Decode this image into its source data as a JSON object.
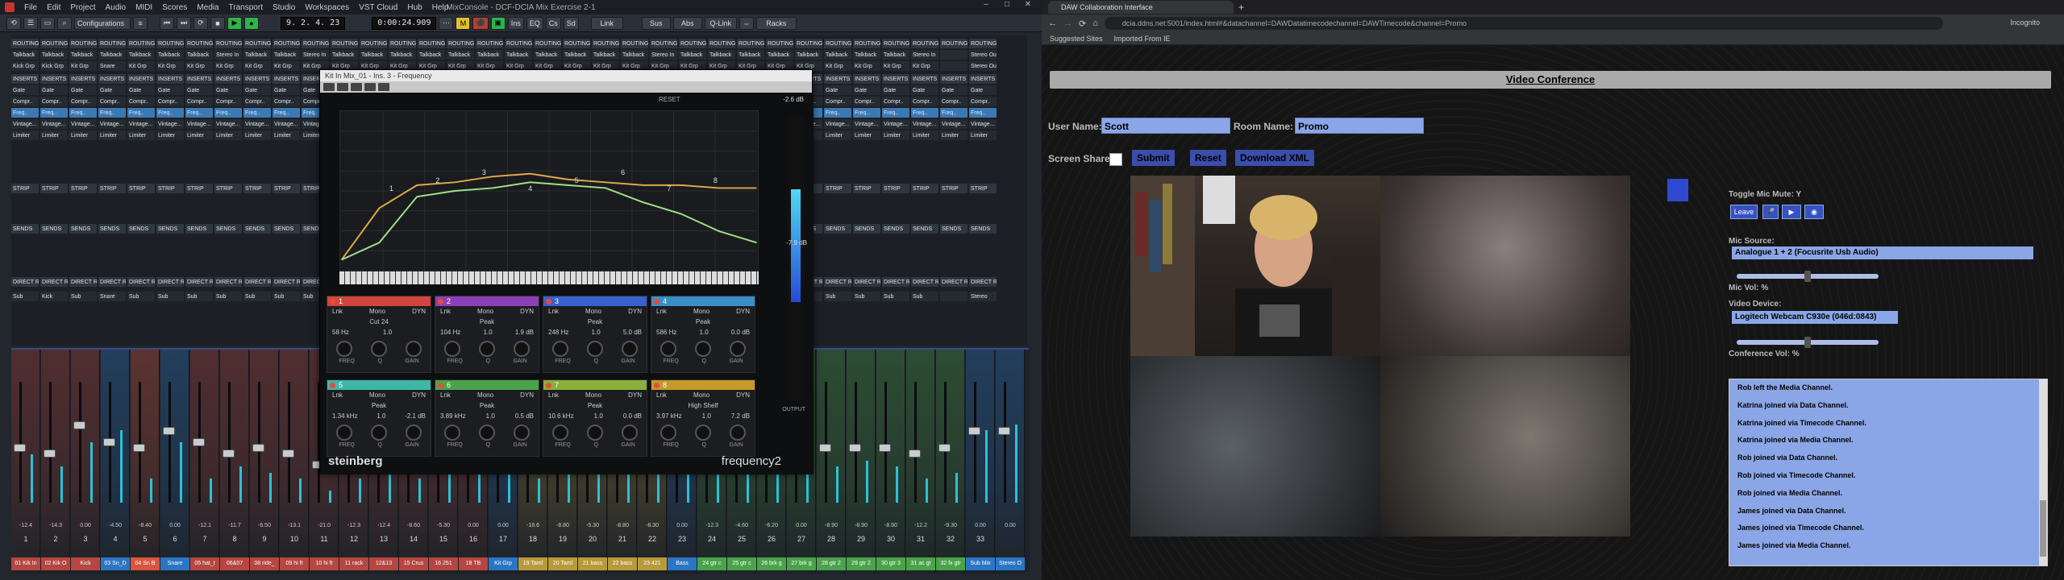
{
  "cubase": {
    "app_title": "MixConsole - DCF-DCIA Mix Exercise 2-1",
    "menu": [
      "File",
      "Edit",
      "Project",
      "Audio",
      "MIDI",
      "Scores",
      "Media",
      "Transport",
      "Studio",
      "Workspaces",
      "VST Cloud",
      "Hub",
      "Help"
    ],
    "window_controls": [
      "–",
      "□",
      "✕"
    ],
    "toolbar": {
      "configurations": "Configurations",
      "position": "9. 2. 4. 23",
      "timecode": "0:00:24.909",
      "metronome": "M",
      "sync_button": "Link",
      "buttons": [
        "Ins",
        "EQ",
        "Cs",
        "Sd"
      ],
      "sus_label": "Sus",
      "abs_label": "Abs",
      "q_link_label": "Q-Link",
      "racks_label": "Racks"
    },
    "rack_rows": {
      "routing": [
        "ROUTING",
        "ROUTING",
        "ROUTING",
        "ROUTING",
        "ROUTING",
        "ROUTING",
        "ROUTING",
        "ROUTING",
        "ROUTING",
        "ROUTING",
        "ROUTING",
        "ROUTING",
        "ROUTING",
        "ROUTING",
        "ROUTING",
        "ROUTING",
        "ROUTING",
        "ROUTING",
        "ROUTING",
        "ROUTING",
        "ROUTING",
        "ROUTING",
        "ROUTING",
        "ROUTING",
        "ROUTING",
        "ROUTING",
        "ROUTING",
        "ROUTING",
        "ROUTING",
        "ROUTING",
        "ROUTING",
        "ROUTING",
        "ROUTING",
        "ROUTING"
      ],
      "inputs": [
        "Talkback",
        "Talkback",
        "Talkback",
        "Talkback",
        "Talkback",
        "Talkback",
        "Talkback",
        "Stereo In",
        "Talkback",
        "Talkback",
        "Stereo In",
        "Talkback",
        "Talkback",
        "Talkback",
        "Talkback",
        "Talkback",
        "Talkback",
        "Talkback",
        "Talkback",
        "Talkback",
        "Talkback",
        "Talkback",
        "Stereo In",
        "Talkback",
        "Talkback",
        "Talkback",
        "Talkback",
        "Talkback",
        "Talkback",
        "Talkback",
        "Talkback",
        "Stereo In",
        "",
        "Stereo Out"
      ],
      "outputs": [
        "Kick Grp",
        "Kick Grp",
        "Kit Grp",
        "Snare",
        "Kit Grp",
        "Kit Grp",
        "Kit Grp",
        "Kit Grp",
        "Kit Grp",
        "Kit Grp",
        "Kit Grp",
        "Kit Grp",
        "Kit Grp",
        "Kit Grp",
        "Kit Grp",
        "Kit Grp",
        "Kit Grp",
        "Kit Grp",
        "Kit Grp",
        "Kit Grp",
        "Kit Grp",
        "Kit Grp",
        "Kit Grp",
        "Kit Grp",
        "Kit Grp",
        "Kit Grp",
        "Kit Grp",
        "Kit Grp",
        "Kit Grp",
        "Kit Grp",
        "Kit Grp",
        "Kit Grp",
        "",
        "Stereo Out"
      ],
      "inserts": [
        "INSERTS",
        "INSERTS",
        "INSERTS",
        "INSERTS",
        "INSERTS",
        "INSERTS",
        "INSERTS",
        "INSERTS",
        "INSERTS",
        "INSERTS",
        "INSERTS",
        "INSERTS",
        "INSERTS",
        "INSERTS",
        "INSERTS",
        "INSERTS",
        "INSERTS",
        "INSERTS",
        "INSERTS",
        "INSERTS",
        "INSERTS",
        "INSERTS",
        "INSERTS",
        "INSERTS",
        "INSERTS",
        "INSERTS",
        "INSERTS",
        "INSERTS",
        "INSERTS",
        "INSERTS",
        "INSERTS",
        "INSERTS",
        "INSERTS",
        "INSERTS"
      ],
      "gate": [
        "Gate",
        "Gate",
        "Gate",
        "Gate",
        "Gate",
        "Gate",
        "Gate",
        "Gate",
        "Gate",
        "Gate",
        "Gate",
        "Gate",
        "Gate",
        "Gate",
        "Gate",
        "Gate",
        "Gate",
        "Gate",
        "Gate",
        "Gate",
        "Gate",
        "Gate",
        "Gate",
        "Gate",
        "Gate",
        "Gate",
        "Gate",
        "Gate",
        "Gate",
        "Gate",
        "Gate",
        "Gate",
        "Gate",
        "Gate"
      ],
      "comp": [
        "Compr..",
        "Compr..",
        "Compr..",
        "Compr..",
        "Compr..",
        "Compr..",
        "Compr..",
        "Compr..",
        "Compr..",
        "Compr..",
        "Compr..",
        "Compr..",
        "Compr..",
        "Compr..",
        "Compr..",
        "Compr..",
        "Compr..",
        "Compr..",
        "Compr..",
        "Compr..",
        "Compr..",
        "Compr..",
        "Compr..",
        "Compr..",
        "Compr..",
        "Compr..",
        "Compr..",
        "Compr..",
        "Compr..",
        "Compr..",
        "Compr..",
        "Compr..",
        "Compr..",
        "Compr.."
      ],
      "eqrow": [
        "Freq..",
        "Freq..",
        "Freq..",
        "Freq..",
        "Freq..",
        "Freq..",
        "Freq..",
        "Freq..",
        "Freq..",
        "Freq..",
        "Freq..",
        "Freq..",
        "Freq..",
        "Freq..",
        "Freq..",
        "Freq..",
        "Freq..",
        "Freq..",
        "Freq..",
        "Freq..",
        "Freq..",
        "Freq..",
        "Freq..",
        "Freq..",
        "Freq..",
        "Freq..",
        "Freq..",
        "Freq..",
        "Freq..",
        "Freq..",
        "Freq..",
        "Freq..",
        "Freq..",
        "Freq.."
      ],
      "vintage": [
        "Vintage...",
        "Vintage...",
        "Vintage...",
        "Vintage...",
        "Vintage...",
        "Vintage...",
        "Vintage...",
        "Vintage...",
        "Vintage...",
        "Vintage...",
        "Vintage...",
        "Vintage...",
        "Vintage...",
        "Vintage...",
        "Vintage...",
        "Vintage...",
        "Vintage...",
        "Vintage...",
        "Vintage...",
        "Vintage...",
        "Vintage...",
        "Vintage...",
        "Vintage...",
        "Vintage...",
        "Vintage...",
        "Vintage...",
        "Vintage...",
        "Vintage...",
        "Vintage...",
        "Vintage...",
        "Vintage...",
        "Vintage...",
        "Vintage...",
        "Vintage..."
      ],
      "limiter": [
        "Limiter",
        "Limiter",
        "Limiter",
        "Limiter",
        "Limiter",
        "Limiter",
        "Limiter",
        "Limiter",
        "Limiter",
        "Limiter",
        "Limiter",
        "Limiter",
        "Limiter",
        "Limiter",
        "Limiter",
        "Limiter",
        "Limiter",
        "Limiter",
        "Limiter",
        "Limiter",
        "Limiter",
        "Limiter",
        "Limiter",
        "Limiter",
        "Limiter",
        "Limiter",
        "Limiter",
        "Limiter",
        "Limiter",
        "Limiter",
        "Limiter",
        "Limiter",
        "Limiter",
        "Limiter"
      ],
      "strip": [
        "STRIP",
        "STRIP",
        "STRIP",
        "STRIP",
        "STRIP",
        "STRIP",
        "STRIP",
        "STRIP",
        "STRIP",
        "STRIP",
        "STRIP",
        "STRIP",
        "STRIP",
        "STRIP",
        "STRIP",
        "STRIP",
        "STRIP",
        "STRIP",
        "STRIP",
        "STRIP",
        "STRIP",
        "STRIP",
        "STRIP",
        "STRIP",
        "STRIP",
        "STRIP",
        "STRIP",
        "STRIP",
        "STRIP",
        "STRIP",
        "STRIP",
        "STRIP",
        "STRIP",
        "STRIP"
      ],
      "sends": [
        "SENDS",
        "SENDS",
        "SENDS",
        "SENDS",
        "SENDS",
        "SENDS",
        "SENDS",
        "SENDS",
        "SENDS",
        "SENDS",
        "SENDS",
        "SENDS",
        "SENDS",
        "SENDS",
        "SENDS",
        "SENDS",
        "SENDS",
        "SENDS",
        "SENDS",
        "SENDS",
        "SENDS",
        "SENDS",
        "SENDS",
        "SENDS",
        "SENDS",
        "SENDS",
        "SENDS",
        "SENDS",
        "SENDS",
        "SENDS",
        "SENDS",
        "SENDS",
        "SENDS",
        "SENDS"
      ],
      "direct": [
        "DIRECT ROU",
        "DIRECT ROU",
        "DIRECT ROU",
        "DIRECT ROU",
        "DIRECT ROU",
        "DIRECT ROU",
        "DIRECT ROU",
        "DIRECT ROU",
        "DIRECT ROU",
        "DIRECT ROU",
        "DIRECT ROU",
        "DIRECT ROU",
        "DIRECT ROU",
        "DIRECT ROU",
        "DIRECT ROU",
        "DIRECT ROU",
        "DIRECT ROU",
        "DIRECT ROU",
        "DIRECT ROU",
        "DIRECT ROU",
        "DIRECT ROU",
        "DIRECT ROU",
        "DIRECT ROU",
        "DIRECT ROU",
        "DIRECT ROU",
        "DIRECT ROU",
        "DIRECT ROU",
        "DIRECT ROU",
        "DIRECT ROU",
        "DIRECT ROU",
        "DIRECT ROU",
        "DIRECT ROU",
        "DIRECT ROU",
        "DIRECT ROU"
      ],
      "bottom": [
        "Sub",
        "Kick",
        "Sub",
        "Snare",
        "Sub",
        "Sub",
        "Sub",
        "Sub",
        "Sub",
        "Sub",
        "Sub",
        "Sub",
        "Sub",
        "Sub",
        "Sub",
        "Sub",
        "Sub",
        "Sub",
        "Sub",
        "Sub",
        "Sub",
        "Sub",
        "Sub",
        "Sub",
        "Sub",
        "Sub",
        "Sub",
        "Sub",
        "Sub",
        "Sub",
        "Sub",
        "Sub",
        "",
        "Stereo"
      ]
    },
    "mixer_channels": [
      {
        "num": "1",
        "name": "01 Kik In",
        "color": "#b54641",
        "val": "-12.4",
        "fader": 0.55,
        "meter": 0.4
      },
      {
        "num": "2",
        "name": "02 Kik O",
        "color": "#b54641",
        "val": "-14.3",
        "fader": 0.6,
        "meter": 0.3
      },
      {
        "num": "3",
        "name": "Kick",
        "color": "#b54641",
        "val": "0.00",
        "fader": 0.35,
        "meter": 0.5
      },
      {
        "num": "4",
        "name": "03 Sn_D",
        "color": "#2a76c4",
        "val": "-4.50",
        "fader": 0.5,
        "meter": 0.6
      },
      {
        "num": "5",
        "name": "04 Sn B",
        "color": "#d9553f",
        "val": "-8.40",
        "fader": 0.55,
        "meter": 0.2
      },
      {
        "num": "6",
        "name": "Snare",
        "color": "#2a76c4",
        "val": "0.00",
        "fader": 0.4,
        "meter": 0.5
      },
      {
        "num": "7",
        "name": "05 hat_t",
        "color": "#b54641",
        "val": "-12.1",
        "fader": 0.5,
        "meter": 0.2
      },
      {
        "num": "8",
        "name": "06&07",
        "color": "#b54641",
        "val": "-11.7",
        "fader": 0.6,
        "meter": 0.3
      },
      {
        "num": "9",
        "name": "08 ride_",
        "color": "#b54641",
        "val": "-6.50",
        "fader": 0.55,
        "meter": 0.25
      },
      {
        "num": "10",
        "name": "09 hi ft",
        "color": "#b54641",
        "val": "-13.1",
        "fader": 0.6,
        "meter": 0.2
      },
      {
        "num": "11",
        "name": "10 hi ft",
        "color": "#b54641",
        "val": "-21.0",
        "fader": 0.7,
        "meter": 0.1
      },
      {
        "num": "12",
        "name": "11 rack",
        "color": "#b54641",
        "val": "-12.3",
        "fader": 0.6,
        "meter": 0.2
      },
      {
        "num": "13",
        "name": "12&13",
        "color": "#b54641",
        "val": "-12.4",
        "fader": 0.6,
        "meter": 0.3
      },
      {
        "num": "14",
        "name": "15 Crus",
        "color": "#b54641",
        "val": "-8.60",
        "fader": 0.55,
        "meter": 0.2
      },
      {
        "num": "15",
        "name": "16 251",
        "color": "#b54641",
        "val": "-5.30",
        "fader": 0.5,
        "meter": 0.3
      },
      {
        "num": "16",
        "name": "18 TB",
        "color": "#b54641",
        "val": "0.00",
        "fader": 0.45,
        "meter": 0.4
      },
      {
        "num": "17",
        "name": "Kit Grp",
        "color": "#2a76c4",
        "val": "0.00",
        "fader": 0.4,
        "meter": 0.6
      },
      {
        "num": "18",
        "name": "19 Taml",
        "color": "#b89a3a",
        "val": "-18.6",
        "fader": 0.65,
        "meter": 0.2
      },
      {
        "num": "19",
        "name": "20 Taml",
        "color": "#b89a3a",
        "val": "-8.80",
        "fader": 0.55,
        "meter": 0.3
      },
      {
        "num": "20",
        "name": "21 bass",
        "color": "#b89a3a",
        "val": "-5.30",
        "fader": 0.5,
        "meter": 0.3
      },
      {
        "num": "21",
        "name": "22 bass",
        "color": "#b89a3a",
        "val": "-8.80",
        "fader": 0.5,
        "meter": 0.35
      },
      {
        "num": "22",
        "name": "23 421",
        "color": "#b89a3a",
        "val": "-8.30",
        "fader": 0.55,
        "meter": 0.3
      },
      {
        "num": "23",
        "name": "Bass",
        "color": "#2a76c4",
        "val": "0.00",
        "fader": 0.4,
        "meter": 0.5
      },
      {
        "num": "24",
        "name": "24 gtr c",
        "color": "#4aa34a",
        "val": "-12.3",
        "fader": 0.55,
        "meter": 0.4
      },
      {
        "num": "25",
        "name": "25 gtr c",
        "color": "#4aa34a",
        "val": "-4.60",
        "fader": 0.5,
        "meter": 0.45
      },
      {
        "num": "26",
        "name": "26 brk g",
        "color": "#4aa34a",
        "val": "-6.20",
        "fader": 0.5,
        "meter": 0.35
      },
      {
        "num": "27",
        "name": "27 brk g",
        "color": "#4aa34a",
        "val": "0.00",
        "fader": 0.45,
        "meter": 0.3
      },
      {
        "num": "28",
        "name": "28 gtr 2",
        "color": "#4aa34a",
        "val": "-8.90",
        "fader": 0.55,
        "meter": 0.3
      },
      {
        "num": "29",
        "name": "29 gtr 2",
        "color": "#4aa34a",
        "val": "-8.90",
        "fader": 0.55,
        "meter": 0.35
      },
      {
        "num": "30",
        "name": "30 gtr 3",
        "color": "#4aa34a",
        "val": "-8.90",
        "fader": 0.55,
        "meter": 0.3
      },
      {
        "num": "31",
        "name": "31 ac gt",
        "color": "#4aa34a",
        "val": "-12.2",
        "fader": 0.6,
        "meter": 0.2
      },
      {
        "num": "32",
        "name": "32 fx gtr",
        "color": "#4aa34a",
        "val": "-9.30",
        "fader": 0.55,
        "meter": 0.25
      },
      {
        "num": "33",
        "name": "Sub Mix",
        "color": "#2a76c4",
        "val": "0.00",
        "fader": 0.4,
        "meter": 0.6
      },
      {
        "num": "",
        "name": "Stereo O",
        "color": "#2a76c4",
        "val": "0.00",
        "fader": 0.4,
        "meter": 0.65
      }
    ],
    "plugin": {
      "title": "Kit In Mix_01 - Ins. 3 - Frequency",
      "brand": "steinberg",
      "product": "frequency2",
      "out_db": "-2.6 dB",
      "out_label": "OUTPUT",
      "out_value": "-7.9 dB",
      "reset": "RESET",
      "eq_chart_data": {
        "type": "line",
        "series": [
          {
            "values": [
              -24,
              -6,
              2,
              3,
              5,
              6,
              4,
              3,
              2,
              2,
              1,
              1
            ]
          },
          {
            "values": [
              -24,
              -18,
              -2,
              0,
              1,
              3,
              2,
              1,
              -4,
              -8,
              -14,
              -18
            ]
          }
        ]
      },
      "bands": [
        {
          "num": "1",
          "color": "#d2453f",
          "type": "Cut 24",
          "mode": "Mono",
          "freq": "58 Hz",
          "q": "1.0",
          "gain": ""
        },
        {
          "num": "2",
          "color": "#8c40b7",
          "type": "Peak",
          "mode": "Mono",
          "freq": "104 Hz",
          "q": "1.0",
          "gain": "1.9 dB"
        },
        {
          "num": "3",
          "color": "#3a5fcf",
          "type": "Peak",
          "mode": "Mono",
          "freq": "248 Hz",
          "q": "1.0",
          "gain": "5.0 dB"
        },
        {
          "num": "4",
          "color": "#3a8fc7",
          "type": "Peak",
          "mode": "Mono",
          "freq": "586 Hz",
          "q": "1.0",
          "gain": "0.0 dB"
        },
        {
          "num": "5",
          "color": "#3fb7a8",
          "type": "Peak",
          "mode": "Mono",
          "freq": "1.34 kHz",
          "q": "1.0",
          "gain": "-2.1 dB"
        },
        {
          "num": "6",
          "color": "#4aa34a",
          "type": "Peak",
          "mode": "Mono",
          "freq": "3.89 kHz",
          "q": "1.0",
          "gain": "0.5 dB"
        },
        {
          "num": "7",
          "color": "#8ab03a",
          "type": "Peak",
          "mode": "Mono",
          "freq": "10.6 kHz",
          "q": "1.0",
          "gain": "0.0 dB"
        },
        {
          "num": "8",
          "color": "#c49a2a",
          "type": "High Shelf",
          "mode": "Mono",
          "freq": "3.97 kHz",
          "q": "1.0",
          "gain": "7.2 dB"
        }
      ],
      "knob_labels": [
        "FREQ",
        "Q",
        "GAIN"
      ],
      "band_on_label": "Lnk",
      "band_mode_label": "DYN"
    }
  },
  "browser": {
    "tab_title": "DAW Collaboration Interface",
    "url": "dcia.ddns.net:5001/index.html#&datachannel=DAWDatatimecodechannel=DAWTimecode&channel=Promo",
    "bookmarks": [
      "Suggested Sites",
      "Imported From IE"
    ],
    "incognito": "Incognito"
  },
  "conference": {
    "header": "Video Conference",
    "user_label": "User Name:",
    "user_value": "Scott",
    "room_label": "Room Name:",
    "room_value": "Promo",
    "share_label": "Screen Share:",
    "submit": "Submit",
    "reset": "Reset",
    "download": "Download XML",
    "toggle_mic": "Toggle Mic Mute: Y",
    "leave": "Leave",
    "mic_source_label": "Mic Source:",
    "mic_source": "Analogue 1 + 2 (Focusrite Usb Audio)",
    "mic_vol_label": "Mic Vol: %",
    "mic_vol": 0.5,
    "video_device_label": "Video Device:",
    "video_device": "Logitech Webcam C930e (046d:0843)",
    "conf_vol_label": "Conference Vol: %",
    "conf_vol": 0.5,
    "accent_color": "#3652c0",
    "log": [
      "Rob left the Media Channel.",
      "Katrina joined via Data Channel.",
      "Katrina joined via Timecode Channel.",
      "Katrina joined via Media Channel.",
      "Rob joined via Data Channel.",
      "Rob joined via Timecode Channel.",
      "Rob joined via Media Channel.",
      "James joined via Data Channel.",
      "James joined via Timecode Channel.",
      "James joined via Media Channel."
    ]
  }
}
